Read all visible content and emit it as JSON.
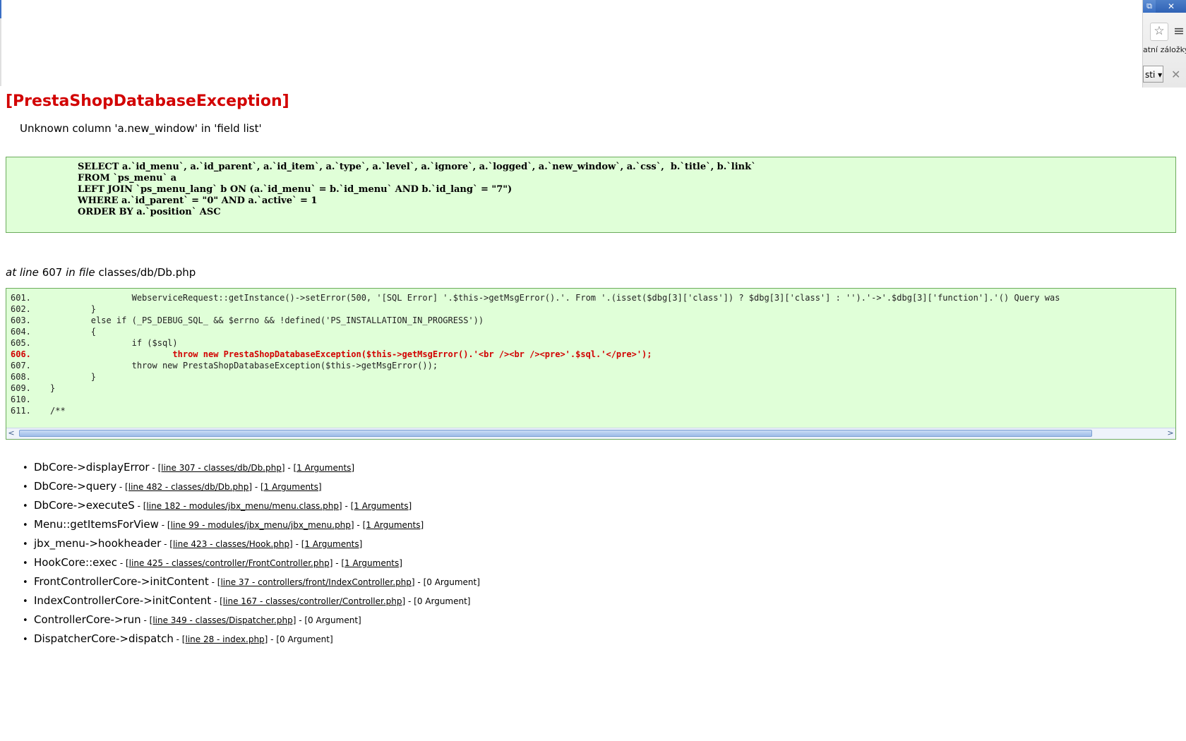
{
  "browser": {
    "restore_glyph": "⧉",
    "close_glyph": "✕",
    "star_glyph": "☆",
    "menu_glyph": "≡",
    "bookmarks_label": "atní záložky",
    "dropdown_label": "sti ▾",
    "bar_close_glyph": "✕"
  },
  "error": {
    "title": "[PrestaShopDatabaseException]",
    "message": "Unknown column 'a.new_window' in 'field list'",
    "sql_lines": [
      "SELECT a.`id_menu`, a.`id_parent`, a.`id_item`, a.`type`, a.`level`, a.`ignore`, a.`logged`, a.`new_window`, a.`css`,  b.`title`, b.`link`",
      "FROM `ps_menu` a",
      "LEFT JOIN `ps_menu_lang` b ON (a.`id_menu` = b.`id_menu` AND b.`id_lang` = \"7\")",
      "WHERE a.`id_parent` = \"0\" AND a.`active` = 1",
      "ORDER BY a.`position` ASC"
    ],
    "location": {
      "at_line_label": "at line",
      "line": "607",
      "in_file_label": "in file",
      "file": "classes/db/Db.php"
    }
  },
  "code": {
    "lines": [
      {
        "num": "601.",
        "text": "                WebserviceRequest::getInstance()->setError(500, '[SQL Error] '.$this->getMsgError().'. From '.(isset($dbg[3]['class']) ? $dbg[3]['class'] : '').'->'.$dbg[3]['function'].'() Query was"
      },
      {
        "num": "602.",
        "text": "        }"
      },
      {
        "num": "603.",
        "text": "        else if (_PS_DEBUG_SQL_ && $errno && !defined('PS_INSTALLATION_IN_PROGRESS'))"
      },
      {
        "num": "604.",
        "text": "        {"
      },
      {
        "num": "605.",
        "text": "                if ($sql)"
      },
      {
        "num": "606.",
        "text": "                        throw new PrestaShopDatabaseException($this->getMsgError().'<br /><br /><pre>'.$sql.'</pre>');"
      },
      {
        "num": "607.",
        "text": "                throw new PrestaShopDatabaseException($this->getMsgError());"
      },
      {
        "num": "608.",
        "text": "        }"
      },
      {
        "num": "609.",
        "text": "}"
      },
      {
        "num": "610.",
        "text": ""
      },
      {
        "num": "611.",
        "text": "/**"
      }
    ],
    "highlighted_line": "606.",
    "scroll_left_glyph": "<",
    "scroll_right_glyph": ">"
  },
  "trace": [
    {
      "func": "DbCore->displayError",
      "link": "[line 307 - classes/db/Db.php]",
      "args": "[1 Arguments]",
      "args_link": true
    },
    {
      "func": "DbCore->query",
      "link": "[line 482 - classes/db/Db.php]",
      "args": "[1 Arguments]",
      "args_link": true
    },
    {
      "func": "DbCore->executeS",
      "link": "[line 182 - modules/jbx_menu/menu.class.php]",
      "args": "[1 Arguments]",
      "args_link": true
    },
    {
      "func": "Menu::getItemsForView",
      "link": "[line 99 - modules/jbx_menu/jbx_menu.php]",
      "args": "[1 Arguments]",
      "args_link": true
    },
    {
      "func": "jbx_menu->hookheader",
      "link": "[line 423 - classes/Hook.php]",
      "args": "[1 Arguments]",
      "args_link": true
    },
    {
      "func": "HookCore::exec",
      "link": "[line 425 - classes/controller/FrontController.php]",
      "args": "[1 Arguments]",
      "args_link": true
    },
    {
      "func": "FrontControllerCore->initContent",
      "link": "[line 37 - controllers/front/IndexController.php]",
      "args": "[0 Argument]",
      "args_link": false
    },
    {
      "func": "IndexControllerCore->initContent",
      "link": "[line 167 - classes/controller/Controller.php]",
      "args": "[0 Argument]",
      "args_link": false
    },
    {
      "func": "ControllerCore->run",
      "link": "[line 349 - classes/Dispatcher.php]",
      "args": "[0 Argument]",
      "args_link": false
    },
    {
      "func": "DispatcherCore->dispatch",
      "link": "[line 28 - index.php]",
      "args": "[0 Argument]",
      "args_link": false
    }
  ],
  "separator": " - ",
  "bullet": "•",
  "colors": {
    "error_red": "#d20000",
    "box_bg": "#e0ffd8",
    "box_border": "#6cab5c"
  }
}
